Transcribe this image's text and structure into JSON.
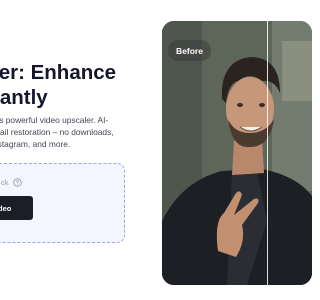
{
  "hero": {
    "heading_lines": [
      "ler: Enhance",
      "tantly"
    ],
    "description_lines": [
      "e's powerful video upscaler. AI-",
      "etail restoration – no downloads,",
      "nstagram, and more."
    ]
  },
  "upload": {
    "hint_text": "ck",
    "help_icon": "question-circle-icon",
    "button_label": "deo"
  },
  "compare": {
    "before_label": "Before"
  },
  "colors": {
    "heading": "#15162b",
    "upload_box_bg": "#f4f5fe",
    "upload_box_border": "#9aa3ee",
    "button_bg": "#1b1d27"
  }
}
